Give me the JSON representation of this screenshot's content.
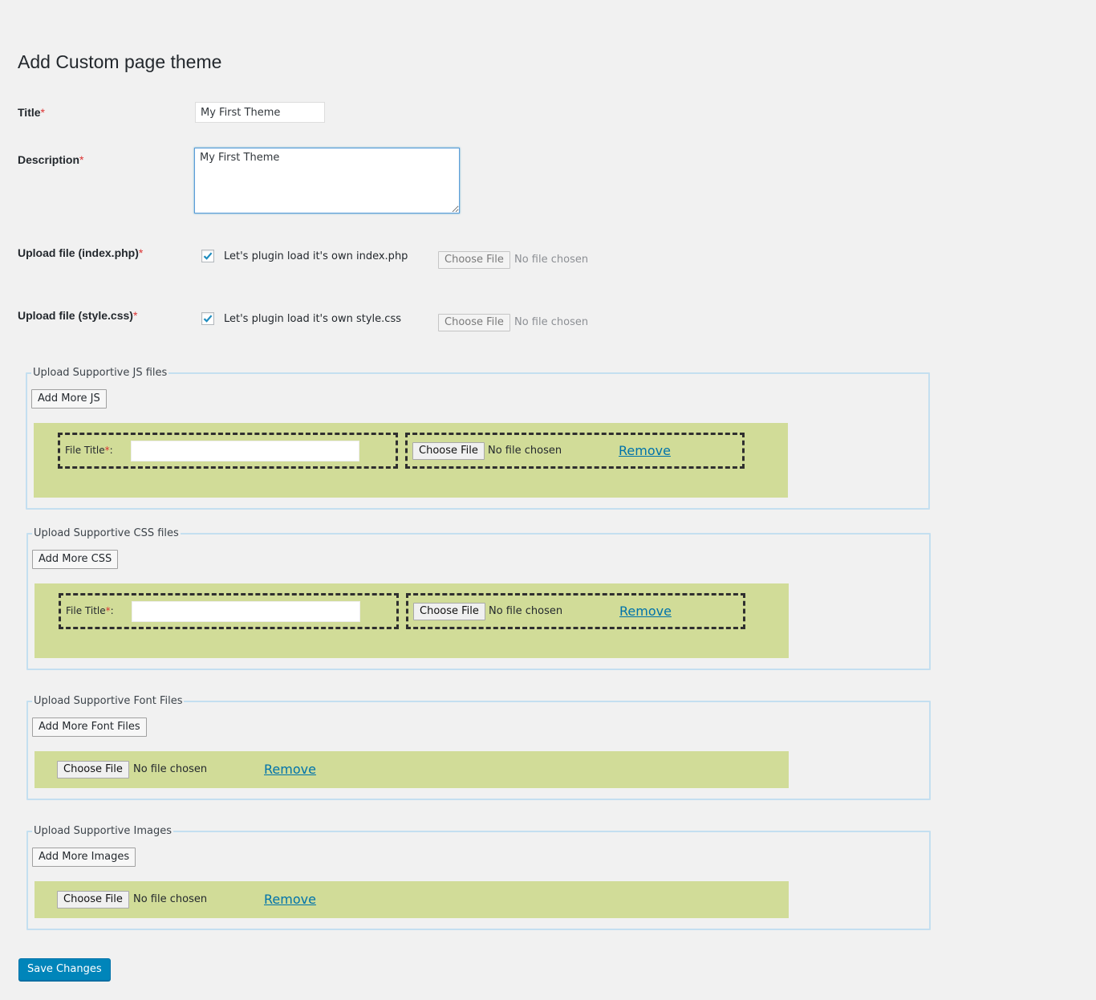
{
  "page": {
    "title": "Add Custom page theme"
  },
  "colors": {
    "accent": "#0085ba",
    "link": "#0073aa",
    "row_bg": "#d1dc98",
    "fieldset_border": "#c4dff0",
    "required": "#dc3232"
  },
  "form": {
    "title": {
      "label": "Title",
      "required": "*",
      "value": "My First Theme"
    },
    "description": {
      "label": "Description",
      "required": "*",
      "value": "My First Theme"
    },
    "upload_index": {
      "label": "Upload file (index.php)",
      "required": "*",
      "checkbox_label": "Let's plugin load it's own index.php",
      "checked": true,
      "file_button": "Choose File",
      "file_status": "No file chosen",
      "icon": "checkmark-icon"
    },
    "upload_style": {
      "label": "Upload file (style.css)",
      "required": "*",
      "checkbox_label": "Let's plugin load it's own style.css",
      "checked": true,
      "file_button": "Choose File",
      "file_status": "No file chosen",
      "icon": "checkmark-icon"
    }
  },
  "sections": {
    "js": {
      "legend": "Upload Supportive JS files",
      "add_button": "Add More JS",
      "row": {
        "file_title_label": "File Title",
        "required": "*",
        "separator": ":",
        "file_title_value": "",
        "file_button": "Choose File",
        "file_status": "No file chosen",
        "remove": "Remove"
      }
    },
    "css": {
      "legend": "Upload Supportive CSS files",
      "add_button": "Add More CSS",
      "row": {
        "file_title_label": "File Title",
        "required": "*",
        "separator": ":",
        "file_title_value": "",
        "file_button": "Choose File",
        "file_status": "No file chosen",
        "remove": "Remove"
      }
    },
    "fonts": {
      "legend": "Upload Supportive Font Files",
      "add_button": "Add More Font Files",
      "row": {
        "file_button": "Choose File",
        "file_status": "No file chosen",
        "remove": "Remove"
      }
    },
    "images": {
      "legend": "Upload Supportive Images",
      "add_button": "Add More Images",
      "row": {
        "file_button": "Choose File",
        "file_status": "No file chosen",
        "remove": "Remove"
      }
    }
  },
  "actions": {
    "save": "Save Changes"
  }
}
